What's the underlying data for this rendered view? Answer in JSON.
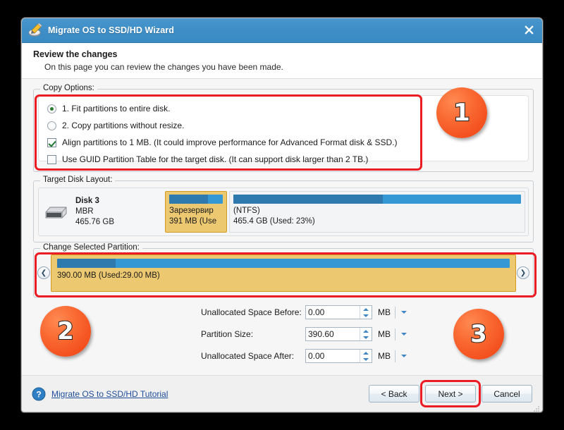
{
  "window": {
    "title": "Migrate OS to SSD/HD Wizard",
    "app_icon": "wizard-disk-icon",
    "close_icon": "close-icon",
    "titlebar_color": "#3f8ec7"
  },
  "header": {
    "title": "Review the changes",
    "subtitle": "On this page you can review the changes you have been made."
  },
  "copy_options": {
    "legend": "Copy Options:",
    "items": [
      {
        "type": "radio",
        "checked": true,
        "label": "1. Fit partitions to entire disk."
      },
      {
        "type": "radio",
        "checked": false,
        "label": "2. Copy partitions without resize."
      },
      {
        "type": "checkbox",
        "checked": true,
        "label": "Align partitions to 1 MB.  (It could improve performance for Advanced Format disk & SSD.)"
      },
      {
        "type": "checkbox",
        "checked": false,
        "label": "Use GUID Partition Table for the target disk. (It can support disk larger than 2 TB.)"
      }
    ]
  },
  "target_disk": {
    "legend": "Target Disk Layout:",
    "disk_icon": "hard-disk-icon",
    "disk_name": "Disk 3",
    "disk_scheme": "MBR",
    "disk_size": "465.76 GB",
    "partitions": [
      {
        "selected": true,
        "label_line1": "Зарезервир",
        "label_line2": "391 MB (Use",
        "used_percent": 72
      },
      {
        "selected": false,
        "label_line1": "(NTFS)",
        "label_line2": "465.4 GB (Used: 23%)",
        "used_percent": 52
      }
    ]
  },
  "change_partition": {
    "legend": "Change Selected Partition:",
    "handle_left_icon": "chevron-left-icon",
    "handle_right_icon": "chevron-right-icon",
    "bar_label": "390.00 MB (Used:29.00 MB)",
    "used_percent": 13
  },
  "size_fields": [
    {
      "label": "Unallocated Space Before:",
      "value": "0.00",
      "unit": "MB"
    },
    {
      "label": "Partition Size:",
      "value": "390.60",
      "unit": "MB"
    },
    {
      "label": "Unallocated Space After:",
      "value": "0.00",
      "unit": "MB"
    }
  ],
  "badges": [
    {
      "number": "1"
    },
    {
      "number": "2"
    },
    {
      "number": "3"
    }
  ],
  "footer": {
    "help_icon": "help-icon",
    "tutorial_link": "Migrate OS to SSD/HD Tutorial",
    "back_label": "< Back",
    "next_label": "Next >",
    "cancel_label": "Cancel"
  },
  "colors": {
    "annotation_red": "#ec1c24",
    "badge_orange": "#f4521f",
    "bar_free": "#3498d4",
    "bar_used": "#2e79ad",
    "selected_partition": "#ecc870",
    "link_blue": "#1e4d9b"
  }
}
